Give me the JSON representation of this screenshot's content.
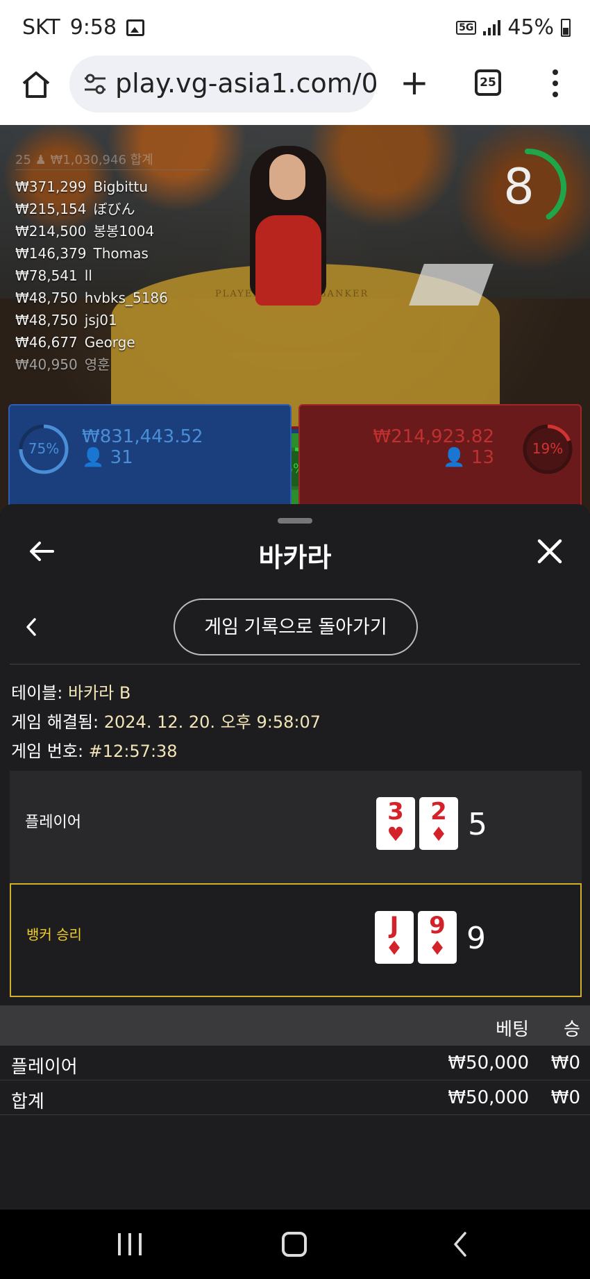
{
  "status": {
    "carrier": "SKT",
    "time": "9:58",
    "network": "5G",
    "battery": "45%"
  },
  "browser": {
    "url": "play.vg-asia1.com/04(",
    "tab_count": "25"
  },
  "game": {
    "header_faded": "25 ♟ ₩1,030,946 합계",
    "table_label_player": "PLAYER",
    "table_label_banker": "BANKER",
    "timer": "8",
    "timer_fraction": 0.4,
    "bets": [
      {
        "amount": "₩371,299",
        "name": "Bigbittu"
      },
      {
        "amount": "₩215,154",
        "name": "ぼびん"
      },
      {
        "amount": "₩214,500",
        "name": "봉봉1004"
      },
      {
        "amount": "₩146,379",
        "name": "Thomas"
      },
      {
        "amount": "₩78,541",
        "name": "ll"
      },
      {
        "amount": "₩48,750",
        "name": "hvbks_5186"
      },
      {
        "amount": "₩48,750",
        "name": "jsj01"
      },
      {
        "amount": "₩46,677",
        "name": "George"
      },
      {
        "amount": "₩40,950",
        "name": "영훈"
      }
    ],
    "player_panel": {
      "percent": "75%",
      "percent_value": 0.75,
      "amount": "₩831,443.52",
      "count": "31"
    },
    "banker_panel": {
      "percent": "19%",
      "percent_value": 0.19,
      "amount": "₩214,923.82",
      "count": "13"
    },
    "tie_panel": {
      "percent": "6%",
      "percent_value": 0.06
    }
  },
  "sheet": {
    "title": "바카라",
    "back_history_label": "게임 기록으로 돌아가기",
    "info": {
      "table_key": "테이블: ",
      "table_val": "바카라 B",
      "resolved_key": "게임 해결됨: ",
      "resolved_val": "2024. 12. 20. 오후 9:58:07",
      "number_key": "게임 번호: ",
      "number_val": "#12:57:38"
    },
    "player_hand": {
      "label": "플레이어",
      "cards": [
        {
          "rank": "3",
          "suit": "♥"
        },
        {
          "rank": "2",
          "suit": "♦"
        }
      ],
      "total": "5"
    },
    "banker_hand": {
      "label": "뱅커 승리",
      "cards": [
        {
          "rank": "J",
          "suit": "♦"
        },
        {
          "rank": "9",
          "suit": "♦"
        }
      ],
      "total": "9"
    },
    "bet_table": {
      "headers": [
        "",
        "베팅",
        "승"
      ],
      "rows": [
        [
          "플레이어",
          "₩50,000",
          "₩0"
        ],
        [
          "합계",
          "₩50,000",
          "₩0"
        ]
      ]
    }
  },
  "colors": {
    "win_border": "#d1b02a",
    "player_blue": "#2c5fb5",
    "banker_red": "#a12828",
    "tie_green": "#2b8e2b"
  }
}
